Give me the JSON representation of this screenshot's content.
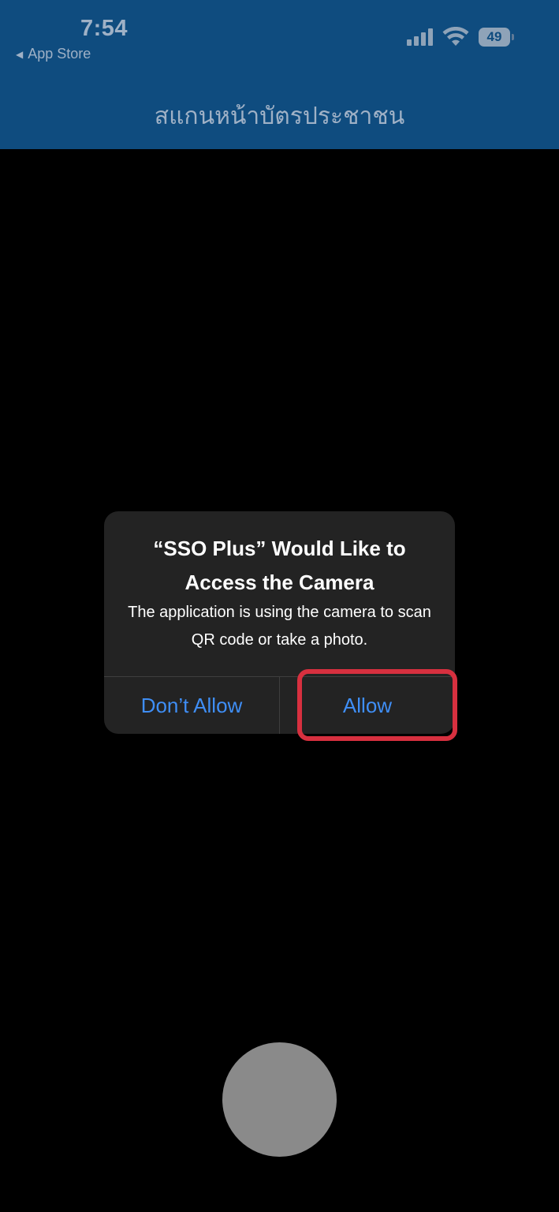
{
  "status_bar": {
    "time": "7:54",
    "back_app": "App Store",
    "battery": "49"
  },
  "header": {
    "title": "สแกนหน้าบัตรประชาชน"
  },
  "dialog": {
    "title": "“SSO Plus” Would Like to Access the Camera",
    "message": "The application is  using the camera to scan QR code or take a photo.",
    "deny_label": "Don’t Allow",
    "allow_label": "Allow"
  },
  "colors": {
    "header_bg": "#0f4c7f",
    "dialog_bg": "#232323",
    "button_text": "#3f8ef5",
    "highlight": "#d7303f",
    "shutter": "#8a8a8a"
  },
  "icons": [
    "back-arrow-icon",
    "cellular-signal-icon",
    "wifi-icon",
    "battery-icon"
  ]
}
